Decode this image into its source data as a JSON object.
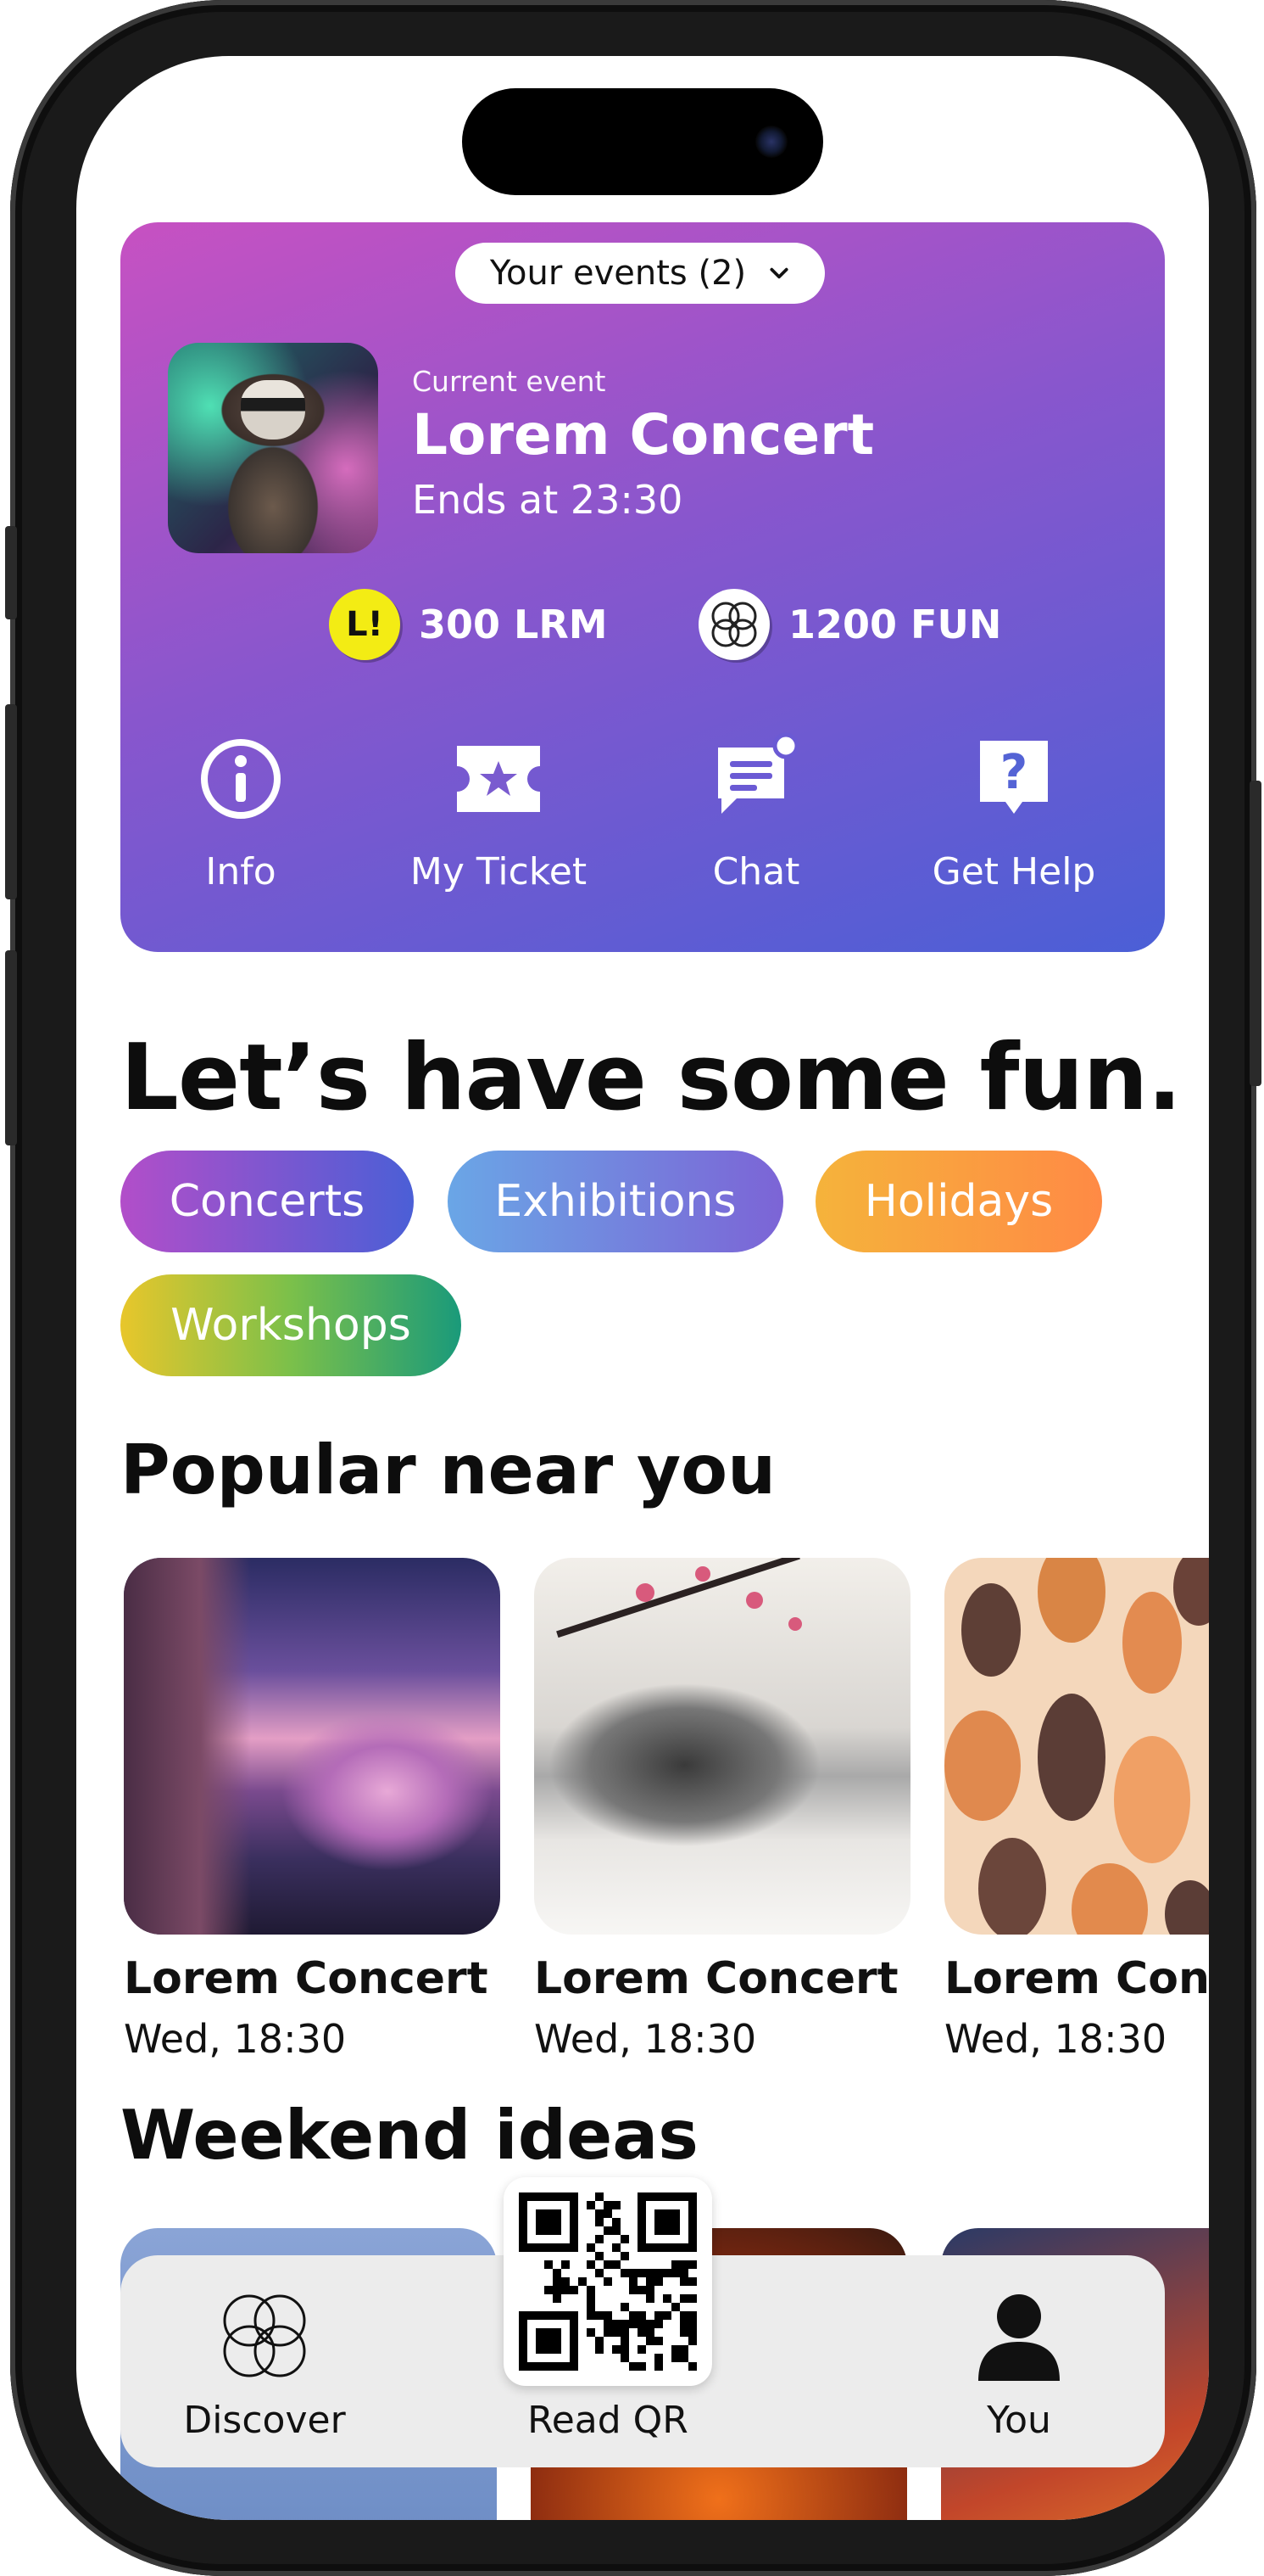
{
  "header": {
    "events_selector": "Your events (2)",
    "current_label": "Current event",
    "event_title": "Lorem Concert",
    "event_ends": "Ends at 23:30",
    "coin_badge": "L!",
    "balance_lrm": "300 LRM",
    "balance_fun": "1200 FUN",
    "actions": [
      {
        "label": "Info",
        "icon": "info-icon"
      },
      {
        "label": "My Ticket",
        "icon": "ticket-icon"
      },
      {
        "label": "Chat",
        "icon": "chat-icon"
      },
      {
        "label": "Get Help",
        "icon": "help-icon"
      }
    ]
  },
  "hero_title": "Let’s have some fun.",
  "categories": [
    "Concerts",
    "Exhibitions",
    "Holidays",
    "Workshops"
  ],
  "popular": {
    "title": "Popular near you",
    "items": [
      {
        "title": "Lorem Concert",
        "date": "Wed, 18:30"
      },
      {
        "title": "Lorem Concert",
        "date": "Wed, 18:30"
      },
      {
        "title": "Lorem Concert",
        "date": "Wed, 18:30"
      }
    ]
  },
  "weekend": {
    "title": "Weekend ideas"
  },
  "nav": {
    "discover": "Discover",
    "read_qr": "Read QR",
    "you": "You"
  },
  "colors": {
    "card_gradient_start": "#c751c2",
    "card_gradient_end": "#4b5fd6",
    "coin_yellow": "#f3ec14"
  }
}
